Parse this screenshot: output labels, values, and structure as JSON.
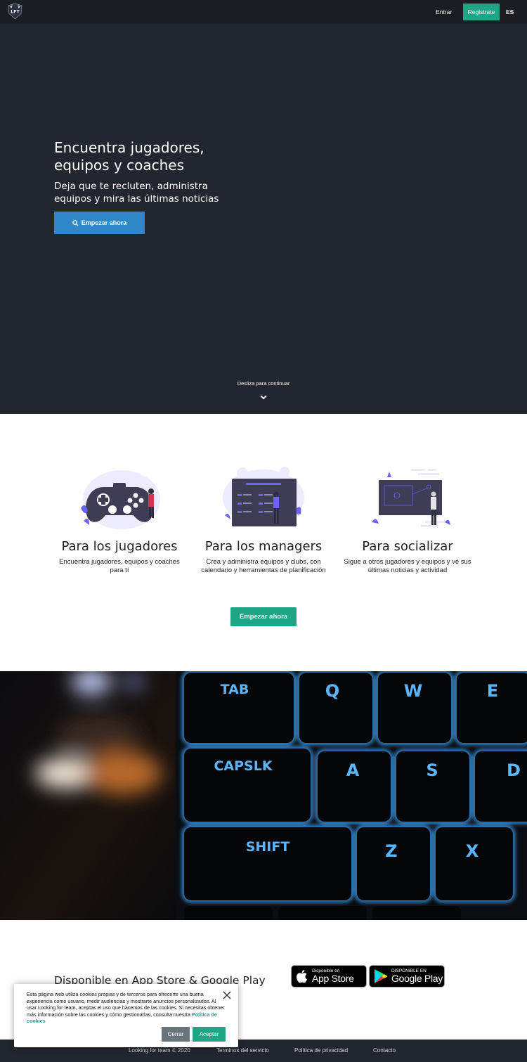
{
  "nav": {
    "logo_text": "LFT",
    "login_label": "Entrar",
    "register_label": "Registrate",
    "language_label": "ES"
  },
  "hero": {
    "title": "Encuentra jugadores, equipos y coaches",
    "subtitle": "Deja que te recluten, administra equipos y mira las últimas noticias",
    "cta_label": "Empezar ahora",
    "cta_icon": "search-icon",
    "scroll_hint": "Desliza para continuar",
    "scroll_icon": "chevron-down-icon"
  },
  "features": {
    "items": [
      {
        "title": "Para los jugadores",
        "description": "Encuentra jugadores, equipos y coaches para tí"
      },
      {
        "title": "Para los managers",
        "description": "Crea y administra equipos y clubs, con calendario y herramientas de planificación"
      },
      {
        "title": "Para socializar",
        "description": "Sigue a otros jugadores y equipos y vé sus últimas noticias y actividad"
      }
    ],
    "cta_label": "Empezar ahora"
  },
  "keyboard": {
    "keys": [
      "TAB",
      "Q",
      "W",
      "E",
      "CAPSLK",
      "A",
      "S",
      "D",
      "SHIFT",
      "Z",
      "X"
    ]
  },
  "stores": {
    "title": "Disponible en App Store & Google Play",
    "app_store_small": "Disponible en",
    "app_store_big": "App Store",
    "google_play_small": "DISPONIBLE EN",
    "google_play_big": "Google Play"
  },
  "footer": {
    "copyright": "Looking for team © 2020",
    "terms": "Terminos del servicio",
    "privacy": "Política de privacidad",
    "contact": "Contacto"
  },
  "cookie": {
    "text": "Esta página web utiliza cookies propias y de terceros para ofrecerte una buena experiencia como usuario, medir audiencias y mostrarte anuncios personalizados. Al usar Looking for team, aceptas el uso que hacemos de las cookies. Si necesitas obtener más información sobre las cookies y cómo gestionarlas, consulta nuestra",
    "link": "Política de cookies",
    "close_label": "Cerrar",
    "accept_label": "Aceptar"
  },
  "colors": {
    "accent_green": "#1fa486",
    "accent_blue": "#2f87c8",
    "dark_bg": "#22262e",
    "illustration_purple": "#6c63ff"
  }
}
